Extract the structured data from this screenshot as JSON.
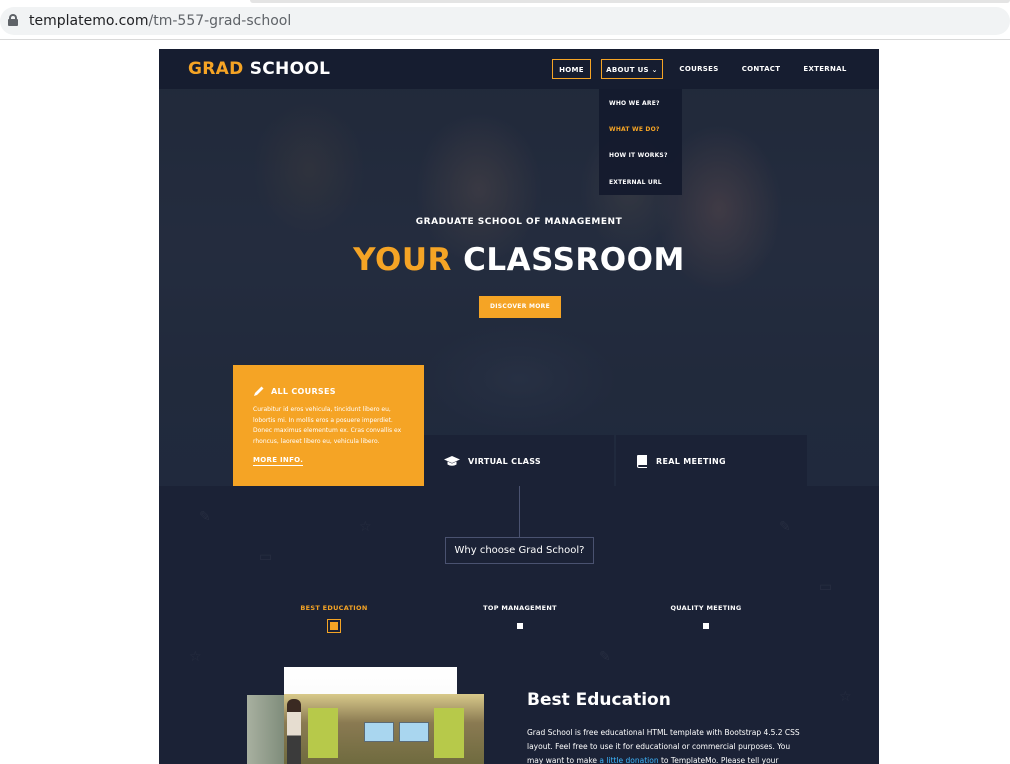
{
  "browser": {
    "url_domain": "templatemo.com",
    "url_path": "/tm-557-grad-school"
  },
  "nav": {
    "logo_accent": "GRAD",
    "logo_main": "SCHOOL",
    "items": [
      {
        "label": "HOME"
      },
      {
        "label": "ABOUT US"
      },
      {
        "label": "COURSES"
      },
      {
        "label": "CONTACT"
      },
      {
        "label": "EXTERNAL"
      }
    ],
    "about_chevron": "⌄",
    "dropdown": [
      {
        "label": "WHO WE ARE?"
      },
      {
        "label": "WHAT WE DO?"
      },
      {
        "label": "HOW IT WORKS?"
      },
      {
        "label": "EXTERNAL URL"
      }
    ]
  },
  "hero": {
    "subtitle": "GRADUATE SCHOOL OF MANAGEMENT",
    "title_accent": "YOUR",
    "title_main": "CLASSROOM",
    "button": "DISCOVER MORE"
  },
  "features": {
    "courses": {
      "title": "ALL COURSES",
      "text": "Curabitur id eros vehicula, tincidunt libero eu, lobortis mi. In mollis eros a posuere imperdiet. Donec maximus elementum ex. Cras convallis ex rhoncus, laoreet libero eu, vehicula libero.",
      "link": "MORE INFO."
    },
    "virtual": {
      "title": "VIRTUAL CLASS"
    },
    "real": {
      "title": "REAL MEETING"
    }
  },
  "why": {
    "label": "Why choose Grad School?",
    "tabs": [
      {
        "label": "BEST EDUCATION"
      },
      {
        "label": "TOP MANAGEMENT"
      },
      {
        "label": "QUALITY MEETING"
      }
    ]
  },
  "content": {
    "title": "Best Education",
    "text_1": "Grad School is free educational HTML template with Bootstrap 4.5.2 CSS layout. Feel free to use it for educational or commercial purposes. You may want to make ",
    "link": "a little donation",
    "text_2": " to TemplateMo. Please tell your"
  },
  "colors": {
    "accent": "#f5a425",
    "dark": "#1b2236",
    "link": "#3fb7ff"
  }
}
